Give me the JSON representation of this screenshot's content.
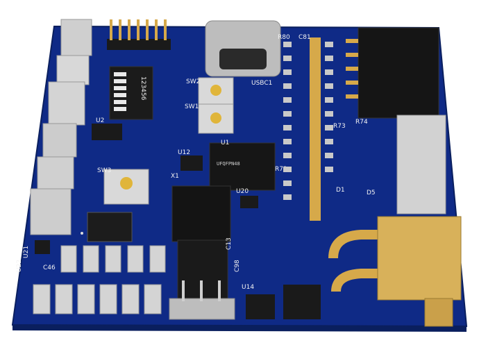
{
  "board": {
    "colors": {
      "pcb": "#0f2a86",
      "pcb_edge": "#0a1f5e",
      "gold": "#d6a94a",
      "white_connector": "#cfcfcf",
      "black_part": "#151515"
    },
    "labels": {
      "sw1": "SW1",
      "sw2": "SW2",
      "sw3": "SW3",
      "usbc1": "USBC1",
      "u1": "U1",
      "u2": "U2",
      "u12": "U12",
      "u14": "U14",
      "u20": "U20",
      "u21": "U21",
      "u22": "U22",
      "x1": "X1",
      "r80": "R80",
      "c81": "C81",
      "r73": "R73",
      "r74": "R74",
      "r72": "R72",
      "c13": "C13",
      "c98": "C98",
      "c46": "C46",
      "d1": "D1",
      "d5": "D5",
      "ufqfpn48": "UFQFPN48",
      "dip_numbers": "123456"
    }
  }
}
